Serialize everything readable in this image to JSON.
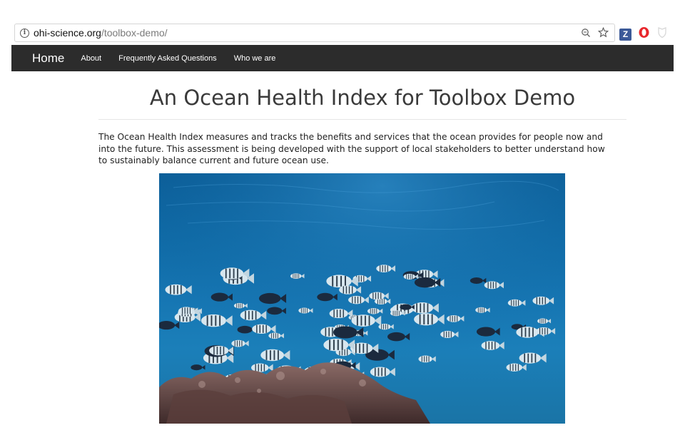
{
  "browser": {
    "url_host": "ohi-science.org",
    "url_path": "/toolbox-demo/",
    "extension_z_label": "Z"
  },
  "navbar": {
    "brand": "Home",
    "links": [
      "About",
      "Frequently Asked Questions",
      "Who we are"
    ]
  },
  "page": {
    "title": "An Ocean Health Index for Toolbox Demo",
    "intro": "The Ocean Health Index measures and tracks the benefits and services that the ocean provides for people now and into the future. This assessment is being developed with the support of local stakeholders to better understand how to sustainably balance current and future ocean use."
  },
  "hero_image": {
    "subject": "underwater-reef-with-fish-school",
    "colors": {
      "water_top": "#0b5d97",
      "water_bottom": "#1b7fb9",
      "reef": "#6e4a45"
    }
  },
  "icons": [
    "info-icon",
    "zoom-icon",
    "star-icon",
    "opera-icon",
    "shield-icon"
  ]
}
